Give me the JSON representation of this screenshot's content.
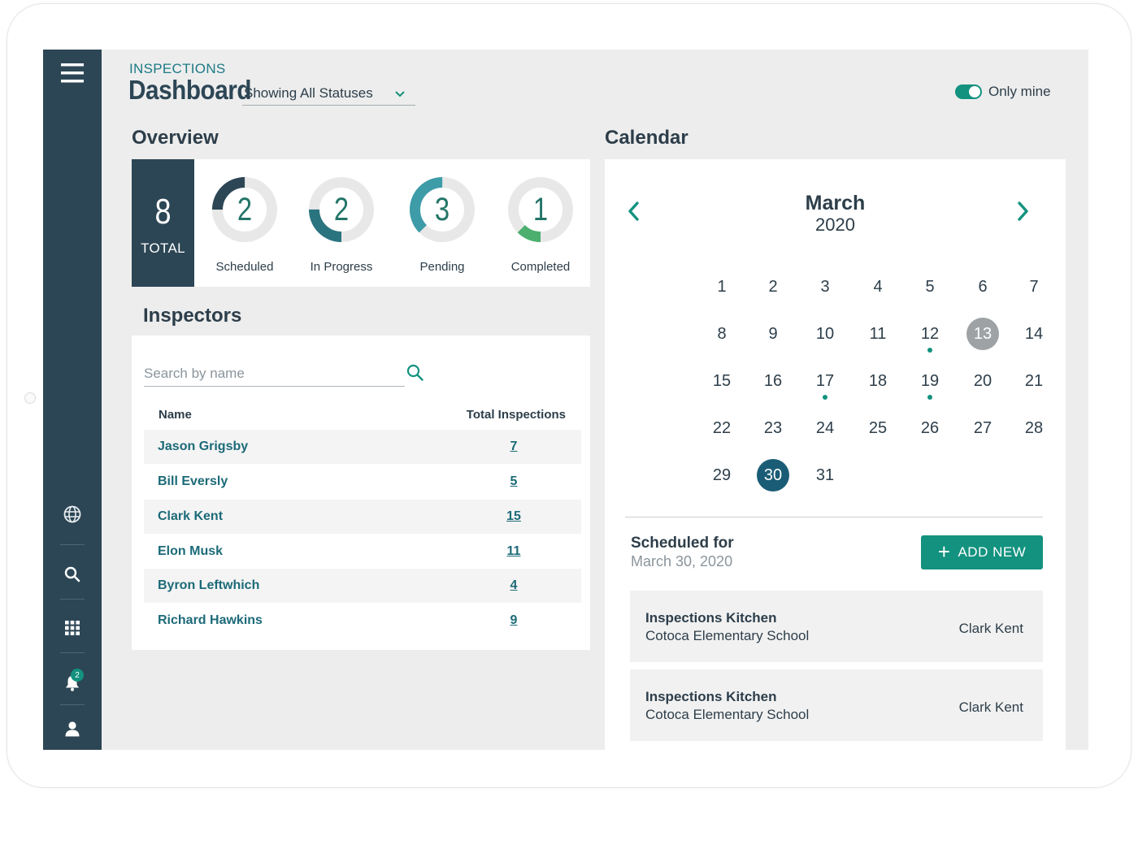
{
  "header": {
    "kicker": "INSPECTIONS",
    "title": "Dashboard",
    "status_filter": "Showing All Statuses",
    "only_mine_label": "Only mine",
    "only_mine_on": true
  },
  "sidebar": {
    "icons": [
      "menu-icon",
      "globe-icon",
      "search-icon",
      "grid-icon",
      "bell-icon",
      "user-icon"
    ],
    "notification_count": "2",
    "color": "#2c4655"
  },
  "overview": {
    "title": "Overview",
    "total": "8",
    "total_label": "TOTAL",
    "stats": [
      {
        "label": "Scheduled",
        "count": "2",
        "fraction": 0.25,
        "color": "#2c4655"
      },
      {
        "label": "In Progress",
        "count": "2",
        "fraction": 0.25,
        "color": "#2a7480"
      },
      {
        "label": "Pending",
        "count": "3",
        "fraction": 0.375,
        "color": "#3d9ca8"
      },
      {
        "label": "Completed",
        "count": "1",
        "fraction": 0.125,
        "color": "#4caf6e"
      }
    ]
  },
  "inspectors": {
    "title": "Inspectors",
    "search_placeholder": "Search by name",
    "col_name": "Name",
    "col_total": "Total Inspections",
    "rows": [
      {
        "name": "Jason Grigsby",
        "count": "7"
      },
      {
        "name": "Bill Eversly",
        "count": "5"
      },
      {
        "name": "Clark Kent",
        "count": "15"
      },
      {
        "name": "Elon Musk",
        "count": "11"
      },
      {
        "name": "Byron Leftwhich",
        "count": "4"
      },
      {
        "name": "Richard Hawkins",
        "count": "9"
      }
    ]
  },
  "calendar": {
    "title": "Calendar",
    "month": "March",
    "year": "2020",
    "weeks": [
      [
        "1",
        "2",
        "3",
        "4",
        "5",
        "6",
        "7"
      ],
      [
        "8",
        "9",
        "10",
        "11",
        "12",
        "13",
        "14"
      ],
      [
        "15",
        "16",
        "17",
        "18",
        "19",
        "20",
        "21"
      ],
      [
        "22",
        "23",
        "24",
        "25",
        "26",
        "27",
        "28"
      ],
      [
        "29",
        "30",
        "31"
      ]
    ],
    "today": "13",
    "selected": "30",
    "event_days": [
      "12",
      "17",
      "19"
    ]
  },
  "schedule": {
    "title": "Scheduled for",
    "date": "March 30, 2020",
    "add_label": "ADD NEW",
    "events": [
      {
        "title": "Inspections Kitchen",
        "location": "Cotoca Elementary School",
        "inspector": "Clark Kent"
      },
      {
        "title": "Inspections Kitchen",
        "location": "Cotoca Elementary School",
        "inspector": "Clark Kent"
      }
    ]
  },
  "colors": {
    "accent": "#13927f",
    "navy": "#2c4655",
    "link": "#1c6a78",
    "selected_day": "#1a5c75",
    "today_day": "#9ea2a5"
  }
}
